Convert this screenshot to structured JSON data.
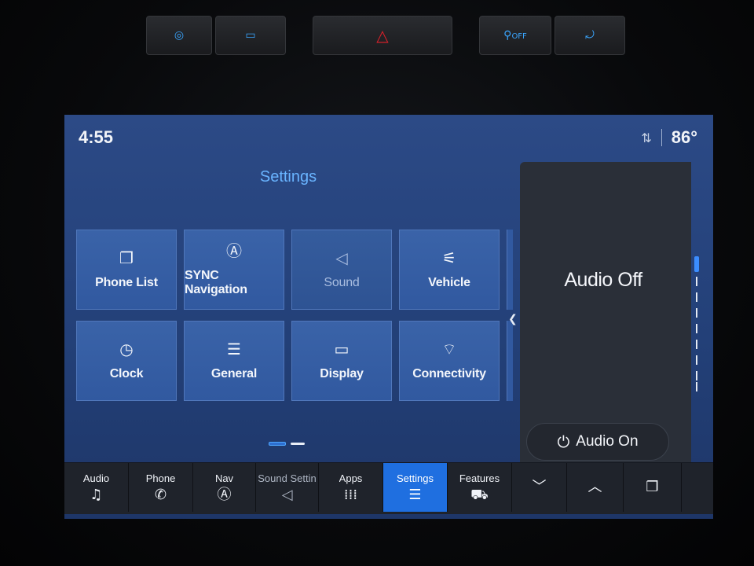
{
  "hardware_buttons": {
    "traction_icon": "traction-control-icon",
    "auto_lamp_icon": "lamp-icon",
    "hazard_icon": "hazard-icon",
    "airbag_off_label": "OFF",
    "seat_icon": "seat-belt-icon"
  },
  "status": {
    "time": "4:55",
    "temperature": "86°"
  },
  "settings": {
    "title": "Settings",
    "tiles": [
      {
        "label": "Phone List",
        "icon": "phone-list-icon"
      },
      {
        "label": "SYNC Navigation",
        "icon": "navigation-icon"
      },
      {
        "label": "Sound",
        "icon": "speaker-icon"
      },
      {
        "label": "Vehicle",
        "icon": "vehicle-icon"
      },
      {
        "label": "Clock",
        "icon": "clock-icon"
      },
      {
        "label": "General",
        "icon": "sliders-icon"
      },
      {
        "label": "Display",
        "icon": "display-icon"
      },
      {
        "label": "Connectivity",
        "icon": "wifi-icon"
      }
    ]
  },
  "audio_panel": {
    "title": "Audio Off",
    "button_label": "Audio On"
  },
  "bottom_nav": [
    {
      "label": "Audio",
      "icon": "music-note-icon"
    },
    {
      "label": "Phone",
      "icon": "phone-icon"
    },
    {
      "label": "Nav",
      "icon": "navigation-icon"
    },
    {
      "label": "Sound Settin",
      "icon": "speaker-icon"
    },
    {
      "label": "Apps",
      "icon": "apps-grid-icon"
    },
    {
      "label": "Settings",
      "icon": "sliders-icon"
    },
    {
      "label": "Features",
      "icon": "truck-icon"
    },
    {
      "label": "",
      "icon": "chevron-down-icon"
    },
    {
      "label": "",
      "icon": "chevron-up-icon"
    },
    {
      "label": "",
      "icon": "windows-icon"
    }
  ],
  "colors": {
    "accent": "#1f6fe0",
    "title_blue": "#69b4ff",
    "hazard_red": "#e0202a"
  }
}
